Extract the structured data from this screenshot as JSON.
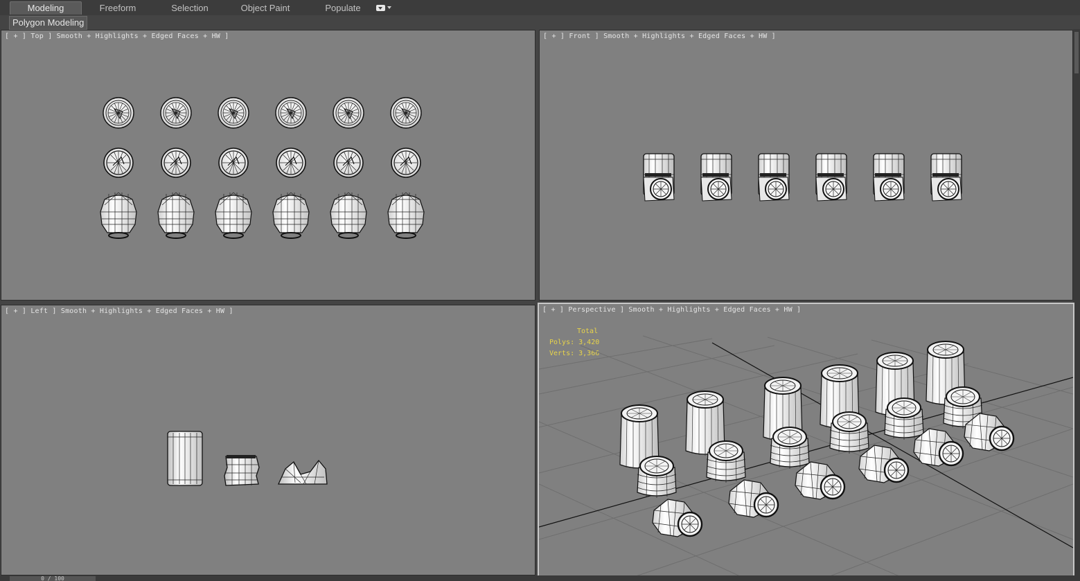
{
  "ribbon": {
    "tabs": [
      "Modeling",
      "Freeform",
      "Selection",
      "Object Paint",
      "Populate"
    ],
    "active_tab": "Modeling",
    "subtab": "Polygon Modeling"
  },
  "viewports": {
    "top": {
      "label": "[ + ] Top ] Smooth + Highlights + Edged Faces + HW ]"
    },
    "front": {
      "label": "[ + ] Front ] Smooth + Highlights + Edged Faces + HW ]"
    },
    "left": {
      "label": "[ + ] Left ] Smooth + Highlights + Edged Faces + HW ]"
    },
    "perspective": {
      "label": "[ + ] Perspective ] Smooth + Highlights + Edged Faces + HW ]",
      "stats": {
        "title": "Total",
        "polys": "Polys: 3,420",
        "verts": "Verts: 3,366"
      }
    }
  },
  "timeline": {
    "frame": "0 / 100"
  },
  "colors": {
    "viewport_bg": "#808080",
    "stats_text": "#e8d44a",
    "ui_dark": "#444444"
  }
}
